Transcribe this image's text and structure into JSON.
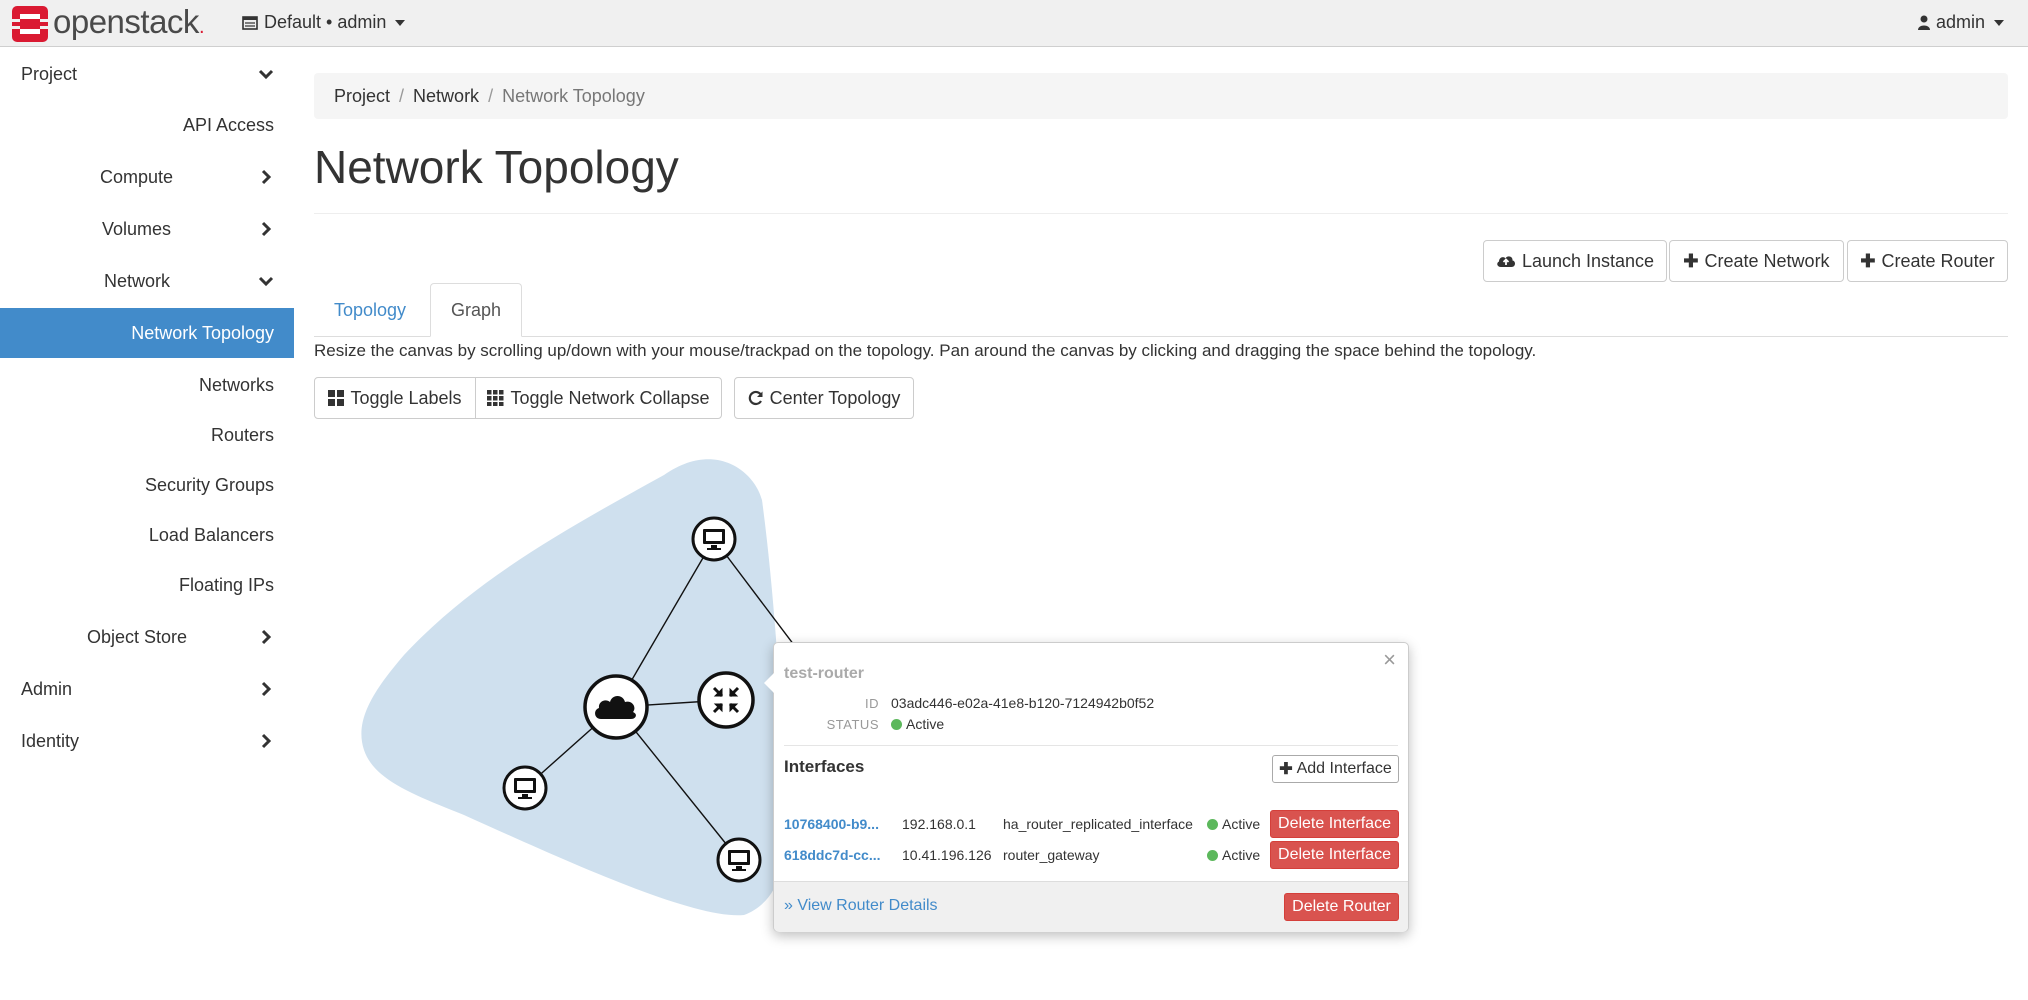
{
  "brand": {
    "name": "openstack",
    "dot": "."
  },
  "project_picker": {
    "label": "Default • admin"
  },
  "user_menu": {
    "label": "admin"
  },
  "sidebar": {
    "project": "Project",
    "api_access": "API Access",
    "compute": "Compute",
    "volumes": "Volumes",
    "network": "Network",
    "network_topology": "Network Topology",
    "networks": "Networks",
    "routers": "Routers",
    "security_groups": "Security Groups",
    "load_balancers": "Load Balancers",
    "floating_ips": "Floating IPs",
    "object_store": "Object Store",
    "admin": "Admin",
    "identity": "Identity"
  },
  "breadcrumb": {
    "project": "Project",
    "network": "Network",
    "current": "Network Topology",
    "separator": "/"
  },
  "page": {
    "title": "Network Topology"
  },
  "actions": {
    "launch_instance": "Launch Instance",
    "create_network": "Create Network",
    "create_router": "Create Router"
  },
  "tabs": {
    "topology": "Topology",
    "graph": "Graph"
  },
  "help_text": "Resize the canvas by scrolling up/down with your mouse/trackpad on the topology. Pan around the canvas by clicking and dragging the space behind the topology.",
  "graph_controls": {
    "toggle_labels": "Toggle Labels",
    "toggle_network_collapse": "Toggle Network Collapse",
    "center_topology": "Center Topology"
  },
  "topology": {
    "nodes": [
      {
        "type": "instance",
        "icon": "monitor-icon"
      },
      {
        "type": "network",
        "icon": "cloud-icon"
      },
      {
        "type": "router",
        "icon": "router-icon"
      },
      {
        "type": "instance",
        "icon": "monitor-icon"
      },
      {
        "type": "instance",
        "icon": "monitor-icon"
      }
    ],
    "network_color": "#cfe0ee"
  },
  "router_popover": {
    "close": "×",
    "title": "test-router",
    "id_label": "ID",
    "id_value": "03adc446-e02a-41e8-b120-7124942b0f52",
    "status_label": "STATUS",
    "status_value": "Active",
    "interfaces_heading": "Interfaces",
    "add_interface": "Add Interface",
    "interfaces": [
      {
        "id": "10768400-b9...",
        "ip": "192.168.0.1",
        "name": "ha_router_replicated_interface",
        "status": "Active",
        "delete": "Delete Interface"
      },
      {
        "id": "618ddc7d-cc...",
        "ip": "10.41.196.126",
        "name": "router_gateway",
        "status": "Active",
        "delete": "Delete Interface"
      }
    ],
    "view_details": "» View Router Details",
    "delete_router": "Delete Router"
  },
  "colors": {
    "primary": "#428bca",
    "danger": "#d9534f",
    "success": "#5cb85c",
    "brand": "#da1a32"
  }
}
